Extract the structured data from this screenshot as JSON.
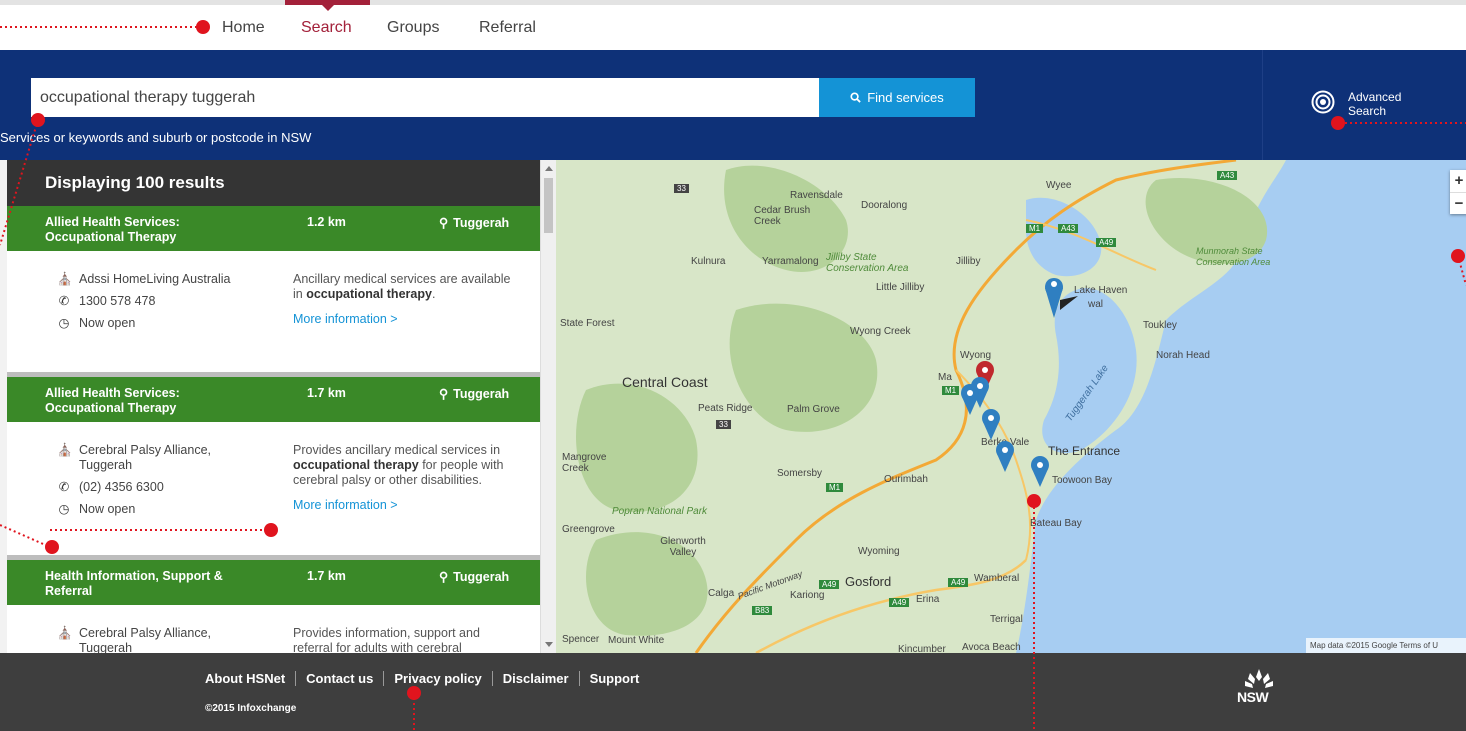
{
  "nav": {
    "tabs": [
      {
        "label": "Home"
      },
      {
        "label": "Search"
      },
      {
        "label": "Groups"
      },
      {
        "label": "Referral"
      }
    ]
  },
  "search": {
    "value": "occupational therapy tuggerah",
    "button_label": "Find services",
    "hint": "Services or keywords and suburb or postcode in NSW"
  },
  "advanced_search": {
    "label": "Advanced Search"
  },
  "results": {
    "header": "Displaying 100 results",
    "items": [
      {
        "category": "Allied Health Services: Occupational Therapy",
        "distance": "1.2 km",
        "location": "Tuggerah",
        "provider": "Adssi HomeLiving Australia",
        "phone": "1300 578 478",
        "status": "Now open",
        "desc_pre": "Ancillary medical services are available in ",
        "desc_kw": "occupational therapy",
        "desc_post": ".",
        "more": "More information >"
      },
      {
        "category": "Allied Health Services: Occupational Therapy",
        "distance": "1.7 km",
        "location": "Tuggerah",
        "provider": "Cerebral Palsy Alliance, Tuggerah",
        "phone": "(02) 4356 6300",
        "status": "Now open",
        "desc_pre": "Provides ancillary medical services in ",
        "desc_kw": "occupational therapy",
        "desc_post": " for people with cerebral palsy or other disabilities.",
        "more": "More information >"
      },
      {
        "category": "Health Information, Support & Referral",
        "distance": "1.7 km",
        "location": "Tuggerah",
        "provider": "Cerebral Palsy Alliance, Tuggerah",
        "desc_pre": "Provides information, support and referral for adults with cerebral",
        "desc_kw": "",
        "desc_post": ""
      }
    ]
  },
  "map": {
    "labels": {
      "ravensdale": "Ravensdale",
      "cedar": "Cedar Brush Creek",
      "dooralong": "Dooralong",
      "wyee": "Wyee",
      "munmorah": "Munmorah State Conservation Area",
      "kulnura": "Kulnura",
      "yarramalong": "Yarramalong",
      "jilliby_sca": "Jilliby State Conservation Area",
      "jilliby": "Jilliby",
      "little_jilliby": "Little Jilliby",
      "lake_haven": "Lake Haven",
      "gwandalan": "wal",
      "toukley": "Toukley",
      "state_forest": "State Forest",
      "wyong_creek": "Wyong Creek",
      "norah_head": "Norah Head",
      "wyong": "Wyong",
      "central_coast": "Central Coast",
      "peats_ridge": "Peats Ridge",
      "palm_grove": "Palm Grove",
      "tuggerah_lake": "Tuggerah Lake",
      "berkeley_vale": "Berke   Vale",
      "the_entrance": "The Entrance",
      "mangrove_creek": "Mangrove Creek",
      "somersby": "Somersby",
      "ourimbah": "Ourimbah",
      "toowoon_bay": "Toowoon Bay",
      "bateau_bay": "Bateau Bay",
      "popran": "Popran National Park",
      "greengrove": "Greengrove",
      "glenworth": "Glenworth Valley",
      "wyoming": "Wyoming",
      "gosford": "Gosford",
      "wamberal": "Wamberal",
      "calga": "Calga",
      "pacific_motorway": "Pacific Motorway",
      "kariong": "Kariong",
      "erina": "Erina",
      "terrigal": "Terrigal",
      "spencer": "Spencer",
      "mount_white": "Mount White",
      "kincumber": "Kincumber",
      "avoca": "Avoca Beach",
      "mannering": "Ma"
    },
    "road_shields": {
      "a43a": "A43",
      "a43b": "A43",
      "m1a": "M1",
      "a49a": "A49",
      "s33": "33",
      "m1b": "M1",
      "m1c": "M1",
      "a49b": "A49",
      "a49c": "A49",
      "a49d": "A49",
      "b83": "B83",
      "s33b": "33"
    },
    "zoom_in": "+",
    "zoom_out": "−",
    "credit": "Map data ©2015 Google   Terms of U",
    "colors": {
      "land": "#d8e6c8",
      "water": "#a7cdf2",
      "forest": "#b5d29b",
      "pin": "#2f7fc1",
      "pin_selected": "#c0282d"
    }
  },
  "footer": {
    "links": [
      "About HSNet",
      "Contact us",
      "Privacy policy",
      "Disclaimer",
      "Support"
    ],
    "copyright": "©2015 Infoxchange",
    "logo_text": "NSW"
  },
  "colors": {
    "brand_navy": "#0e3178",
    "accent_red": "#a3213a",
    "button_blue": "#1493d6",
    "result_green": "#3a8928",
    "annotation_red": "#e0141e"
  }
}
